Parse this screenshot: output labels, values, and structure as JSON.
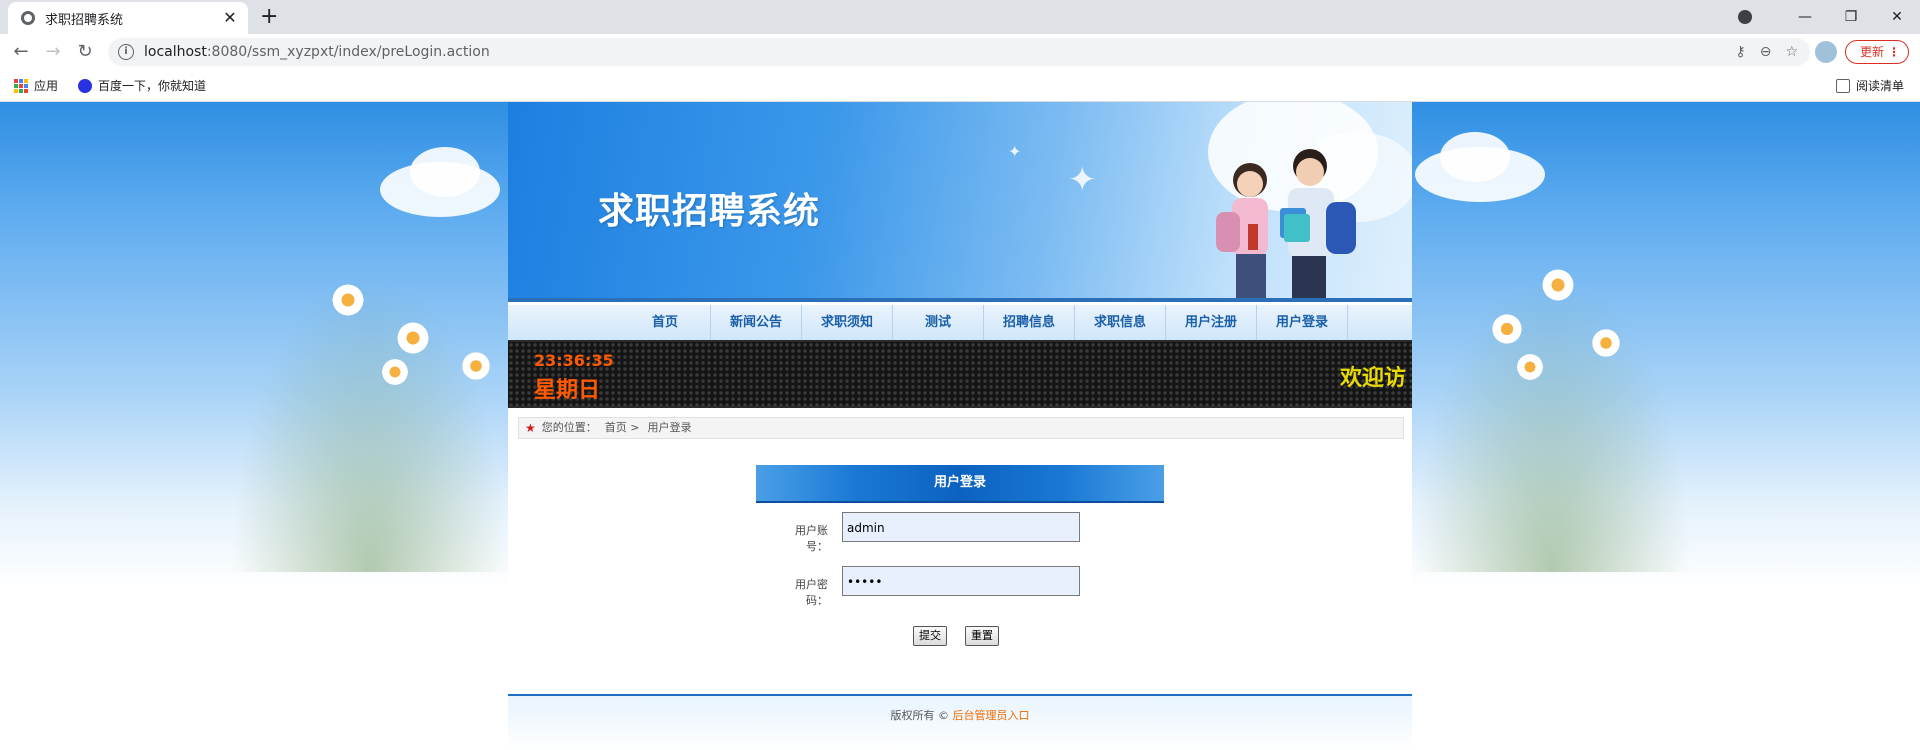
{
  "browser": {
    "tab_title": "求职招聘系统",
    "new_tab": "+",
    "url_host": "localhost",
    "url_path": ":8080/ssm_xyzpxt/index/preLogin.action",
    "update_label": "更新",
    "bookmarks": [
      {
        "label": "应用",
        "icon": "apps-grid-icon"
      },
      {
        "label": "百度一下，你就知道",
        "icon": "baidu-paw-icon"
      }
    ],
    "reading_list": "阅读清单"
  },
  "banner": {
    "site_title": "求职招聘系统"
  },
  "nav": {
    "items": [
      "首页",
      "新闻公告",
      "求职须知",
      "测试",
      "招聘信息",
      "求职信息",
      "用户注册",
      "用户登录"
    ]
  },
  "ticker": {
    "time": "23:36:35",
    "weekday": "星期日",
    "marquee": "欢迎访"
  },
  "breadcrumb": {
    "prefix": "您的位置：",
    "home": "首页 >",
    "current": "用户登录"
  },
  "login": {
    "header": "用户登录",
    "username_label": "用户账号：",
    "username_value": "admin",
    "password_label": "用户密码：",
    "password_value": "•••••",
    "submit_label": "提交",
    "reset_label": "重置"
  },
  "footer": {
    "copyright": "版权所有 ©",
    "admin_link": "后台管理员入口"
  },
  "colors": {
    "nav_text": "#1b5fa8",
    "ticker_time": "#ff5a00",
    "ticker_marquee": "#e8d900",
    "footer_link": "#f26b00",
    "update_red": "#d93025"
  }
}
